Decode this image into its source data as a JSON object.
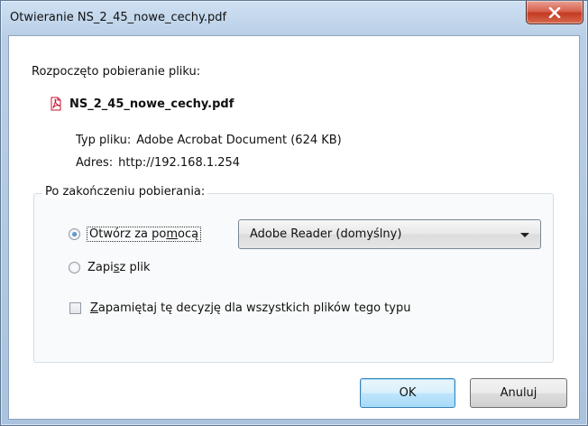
{
  "window": {
    "title": "Otwieranie NS_2_45_nowe_cechy.pdf",
    "close_icon": "close-x-icon"
  },
  "intro_text": "Rozpoczęto pobieranie pliku:",
  "file": {
    "icon": "pdf-file-icon",
    "name": "NS_2_45_nowe_cechy.pdf",
    "type_label": "Typ pliku:",
    "type_value": "Adobe Acrobat Document (624  KB)",
    "address_label": "Adres:",
    "address_value": "http://192.168.1.254"
  },
  "after_download": {
    "legend": "Po zakończeniu pobierania:",
    "open_with": {
      "label_pre": "Otwórz za po",
      "label_u": "m",
      "label_post": "ocą",
      "checked": true
    },
    "app_select": {
      "value": "Adobe Reader  (domyślny)"
    },
    "save_file": {
      "label_pre": "Zapi",
      "label_u": "s",
      "label_post": "z plik",
      "checked": false
    },
    "remember": {
      "label_u": "Z",
      "label_post": "apamiętaj tę decyzję dla wszystkich plików tego typu",
      "checked": false
    }
  },
  "buttons": {
    "ok": "OK",
    "cancel": "Anuluj"
  },
  "colors": {
    "close_red": "#c33a22",
    "pdf_red": "#c8102e",
    "default_button_border": "#3c7fb1"
  }
}
